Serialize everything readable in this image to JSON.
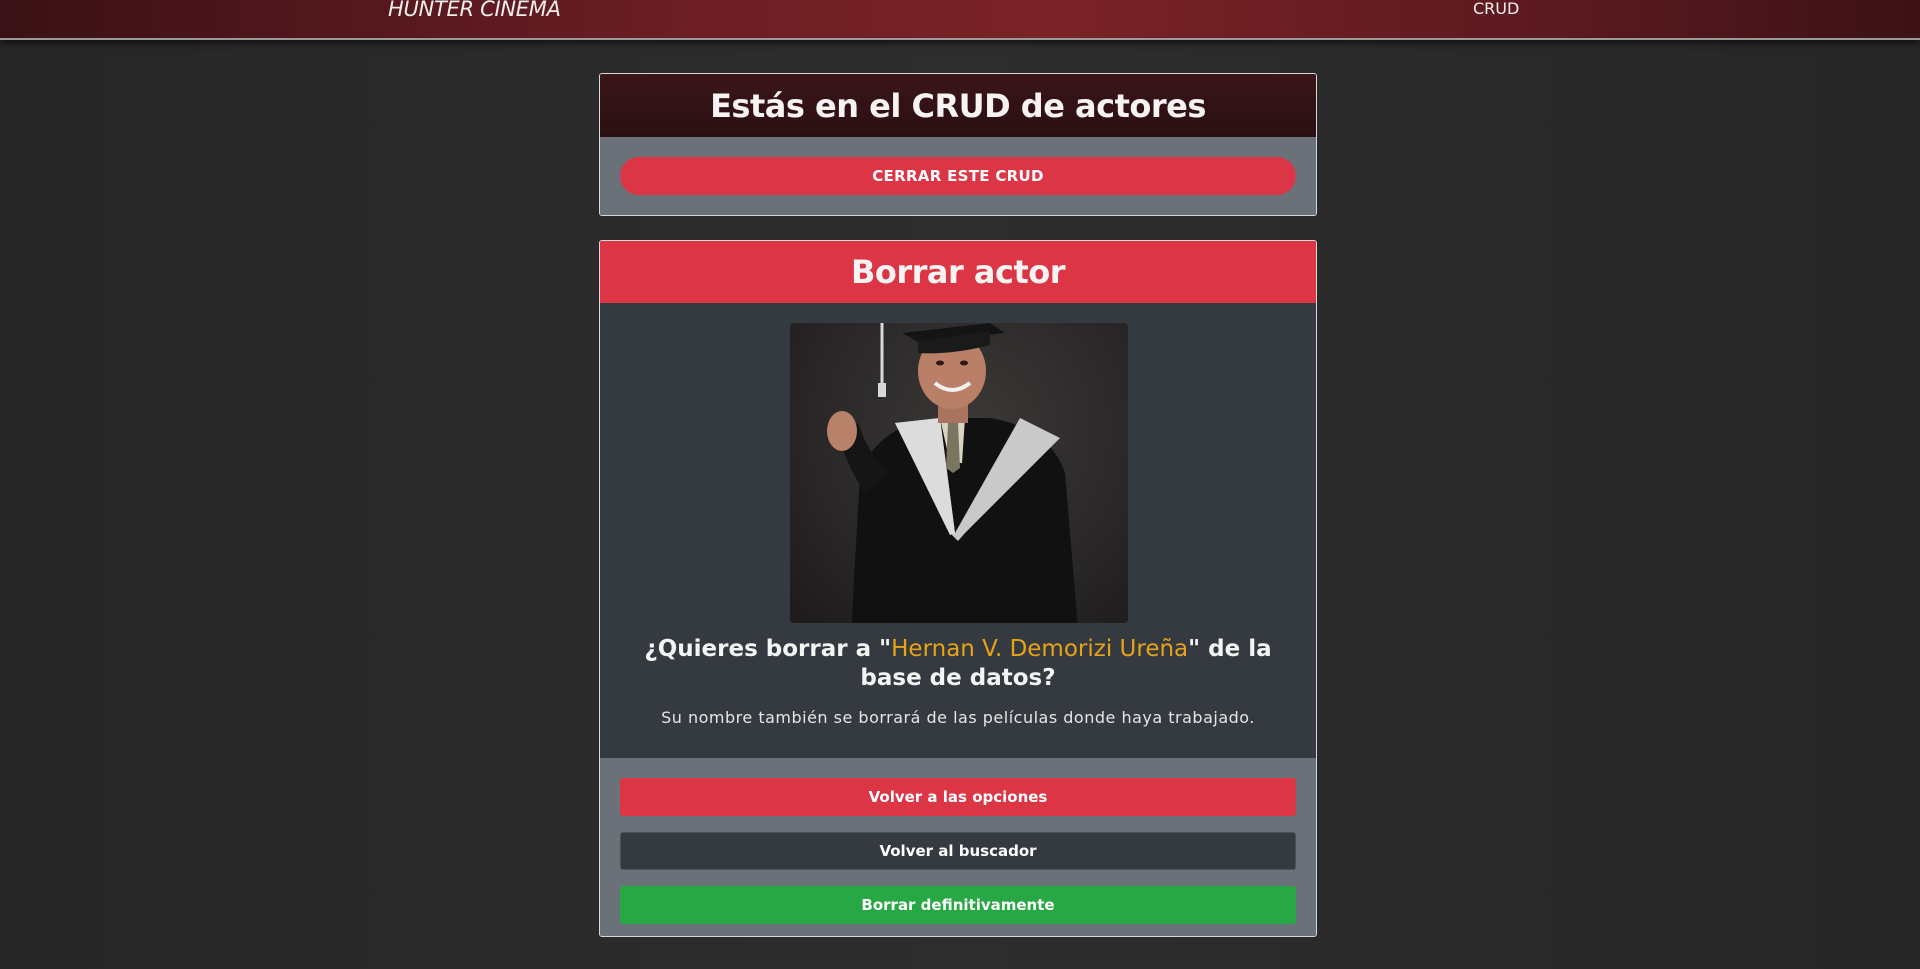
{
  "navbar": {
    "brand": "HUNTER CINEMA",
    "link_crud": "CRUD"
  },
  "crud_card": {
    "title": "Estás en el CRUD de actores",
    "close_button": "CERRAR ESTE CRUD"
  },
  "delete_card": {
    "title": "Borrar actor",
    "question_prefix": "¿Quieres borrar a \"",
    "actor_name": "Hernan V. Demorizi Ureña",
    "question_suffix": "\" de la base de datos?",
    "note": "Su nombre también se borrará de las películas donde haya trabajado.",
    "buttons": {
      "back_options": "Volver a las opciones",
      "back_search": "Volver al buscador",
      "delete_forever": "Borrar definitivamente"
    }
  },
  "colors": {
    "danger": "#dc3545",
    "success": "#28a745",
    "dark": "#343a40",
    "secondary": "#6b7178",
    "highlight": "#e8a317"
  },
  "icons": {
    "actor_photo": "person-graduation-photo"
  }
}
